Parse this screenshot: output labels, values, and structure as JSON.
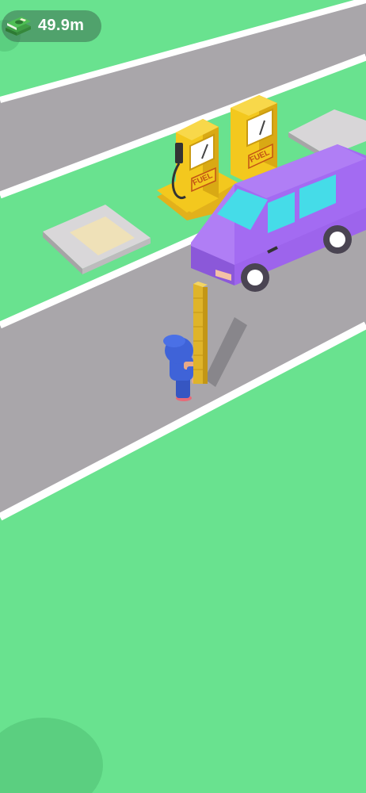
{
  "hud": {
    "money_icon": "cash-stack-icon",
    "money_value": "49.9m"
  },
  "pump_labels": [
    "FUEL",
    "FUEL"
  ],
  "colors": {
    "grass": "#69e28f",
    "road": "#a9a6aa",
    "road_line": "#ffffff",
    "van": "#a36bf2",
    "pump": "#f3c81e",
    "worker": "#3f63d8",
    "pole": "#dfb42a"
  }
}
